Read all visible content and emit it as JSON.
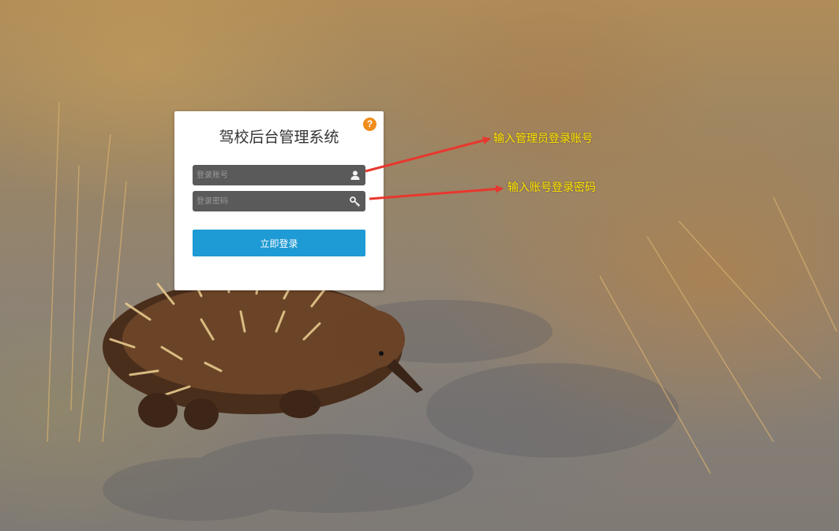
{
  "login": {
    "title": "驾校后台管理系统",
    "help_symbol": "?",
    "account_placeholder": "登录账号",
    "account_value": "",
    "password_placeholder": "登录密码",
    "password_value": "",
    "submit_label": "立即登录",
    "user_icon": "user-icon",
    "key_icon": "key-icon"
  },
  "annotations": {
    "account_note": "输入管理员登录账号",
    "password_note": "输入账号登录密码",
    "color": "#ffe400",
    "arrow_color": "#e8372e"
  },
  "theme": {
    "accent": "#1e9ad4",
    "help_color": "#f08c1a",
    "field_bg": "#5a5a5a"
  }
}
